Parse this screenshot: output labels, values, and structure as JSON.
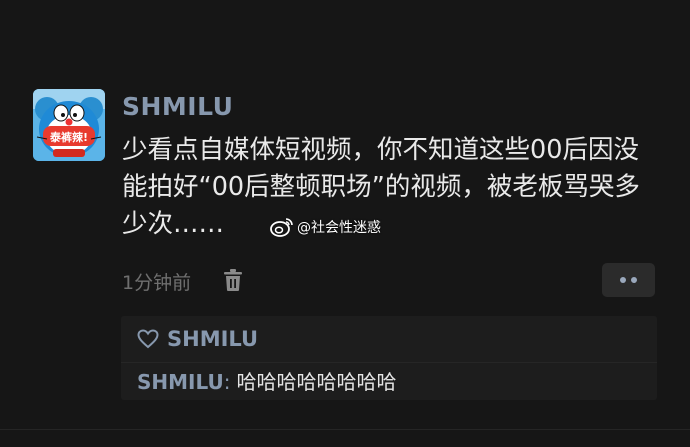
{
  "post": {
    "username": "SHMILU",
    "avatar_label": "泰裤辣!",
    "text": "少看点自媒体短视频，你不知道这些00后因没能拍好“00后整顿职场”的视频，被老板骂哭多少次……",
    "time": "1分钟前"
  },
  "watermark": {
    "text": "@社会性迷惑",
    "icon": "weibo-icon"
  },
  "actions": {
    "delete_icon": "trash-icon",
    "more_icon": "more-dots-icon"
  },
  "likes": {
    "icon": "heart-outline-icon",
    "names": "SHMILU"
  },
  "comment": {
    "author": "SHMILU",
    "separator": ":",
    "text": "哈哈哈哈哈哈哈哈"
  },
  "colors": {
    "background": "#161616",
    "name_blue": "#8798ae",
    "text": "#e9e9e9",
    "muted": "#6f6f6f",
    "panel": "#1d1d1d",
    "button": "#2b2b2b"
  }
}
